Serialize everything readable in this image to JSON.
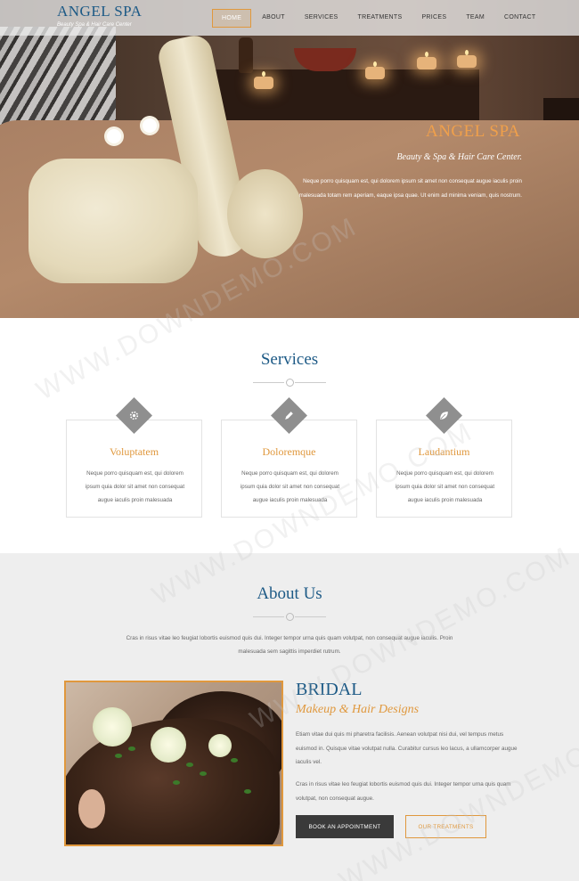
{
  "brand": {
    "name": "ANGEL SPA",
    "tagline": "Beauty Spa & Hair Care Center"
  },
  "nav": {
    "items": [
      {
        "label": "HOME",
        "active": true
      },
      {
        "label": "ABOUT"
      },
      {
        "label": "SERVICES"
      },
      {
        "label": "TREATMENTS"
      },
      {
        "label": "PRICES"
      },
      {
        "label": "TEAM"
      },
      {
        "label": "CONTACT"
      }
    ]
  },
  "hero": {
    "title": "ANGEL SPA",
    "subtitle": "Beauty & Spa & Hair Care Center.",
    "text": "Neque porro quisquam est, qui dolorem ipsum sit amet non consequat augue iaculis proin malesuada totam rem aperiam, eaque ipsa quae. Ut enim ad minima veniam, quis nostrum."
  },
  "services": {
    "title": "Services",
    "cards": [
      {
        "icon": "gear-icon",
        "title": "Voluptatem",
        "text": "Neque porro quisquam est, qui dolorem ipsum quia dolor sit amet non consequat augue iaculis proin malesuada"
      },
      {
        "icon": "pencil-icon",
        "title": "Doloremque",
        "text": "Neque porro quisquam est, qui dolorem ipsum quia dolor sit amet non consequat augue iaculis proin malesuada"
      },
      {
        "icon": "leaf-icon",
        "title": "Laudantium",
        "text": "Neque porro quisquam est, qui dolorem ipsum quia dolor sit amet non consequat augue iaculis proin malesuada"
      }
    ]
  },
  "about": {
    "title": "About Us",
    "text": "Cras in risus vitae leo feugiat lobortis euismod quis dui. Integer tempor urna quis quam volutpat, non consequat augue iaculis. Proin malesuada sem sagittis imperdiet rutrum.",
    "bridal_title": "BRIDAL",
    "bridal_sub": "Makeup & Hair Designs",
    "p1": "Etiam vitae dui quis mi pharetra facilisis. Aenean volutpat nisi dui, vel tempus metus euismod in. Quisque vitae volutpat nulla. Curabitur cursus leo lacus, a ullamcorper augue iaculis vel.",
    "p2": "Cras in risus vitae leo feugiat lobortis euismod quis dui. Integer tempor urna quis quam volutpat, non consequat augue.",
    "btn_primary": "BOOK AN APPOINTMENT",
    "btn_secondary": "OUR TREATMENTS"
  },
  "watermark": "WWW.DOWNDEMO.COM",
  "colors": {
    "accent": "#e0983d",
    "brand": "#1d5a86",
    "about_bg": "#eeeeee"
  }
}
